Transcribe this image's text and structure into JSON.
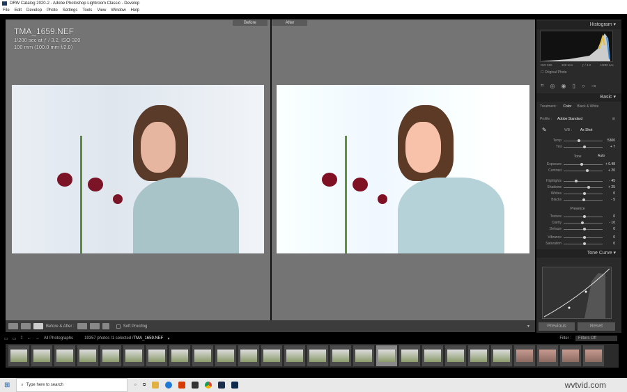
{
  "window": {
    "title": "DRW Catalog 2020-2 - Adobe Photoshop Lightroom Classic - Develop"
  },
  "menu": [
    "File",
    "Edit",
    "Develop",
    "Photo",
    "Settings",
    "Tools",
    "View",
    "Window",
    "Help"
  ],
  "view": {
    "before_label": "Before",
    "after_label": "After",
    "filename": "TMA_1659.NEF",
    "exposure_info": "1/200 sec at ƒ / 3.2, ISO 320",
    "lens_info": "100 mm (100.0 mm f/2.8)"
  },
  "toolbar": {
    "before_after_label": "Before & After :",
    "soft_proofing": "Soft Proofing"
  },
  "panel": {
    "histogram_title": "Histogram",
    "histo_iso": "ISO 320",
    "histo_focal": "100 mm",
    "histo_aperture": "ƒ / 3.2",
    "histo_shutter": "1/200 sec",
    "original_photo": "Original Photo",
    "basic_title": "Basic",
    "treatment_label": "Treatment :",
    "treatment_color": "Color",
    "treatment_bw": "Black & White",
    "profile_label": "Profile :",
    "profile_value": "Adobe Standard",
    "wb_label": "WB :",
    "wb_value": "As Shot",
    "tone_label": "Tone",
    "auto_label": "Auto",
    "presence_label": "Presence",
    "sliders": [
      {
        "label": "Temp",
        "value": "5300",
        "pos": 0.35
      },
      {
        "label": "Tint",
        "value": "+ 7",
        "pos": 0.5
      },
      {
        "label": "Exposure",
        "value": "+ 0.48",
        "pos": 0.42
      },
      {
        "label": "Contrast",
        "value": "+ 20",
        "pos": 0.58
      },
      {
        "label": "Highlights",
        "value": "- 45",
        "pos": 0.28
      },
      {
        "label": "Shadows",
        "value": "+ 25",
        "pos": 0.6
      },
      {
        "label": "Whites",
        "value": "0",
        "pos": 0.5
      },
      {
        "label": "Blacks",
        "value": "- 5",
        "pos": 0.48
      },
      {
        "label": "Texture",
        "value": "0",
        "pos": 0.5
      },
      {
        "label": "Clarity",
        "value": "- 10",
        "pos": 0.45
      },
      {
        "label": "Dehaze",
        "value": "0",
        "pos": 0.5
      },
      {
        "label": "Vibrance",
        "value": "0",
        "pos": 0.5
      },
      {
        "label": "Saturation",
        "value": "0",
        "pos": 0.5
      }
    ],
    "tone_curve_title": "Tone Curve",
    "previous_label": "Previous",
    "reset_label": "Reset"
  },
  "filmstrip": {
    "source": "All Photographs",
    "count": "19357 photos /1 selected /",
    "selected_file": "TMA_1659.NEF",
    "filter_label": "Filter :",
    "filter_value": "Filters Off"
  },
  "taskbar": {
    "search_placeholder": "Type here to search"
  },
  "watermark": "wvtvid.com"
}
